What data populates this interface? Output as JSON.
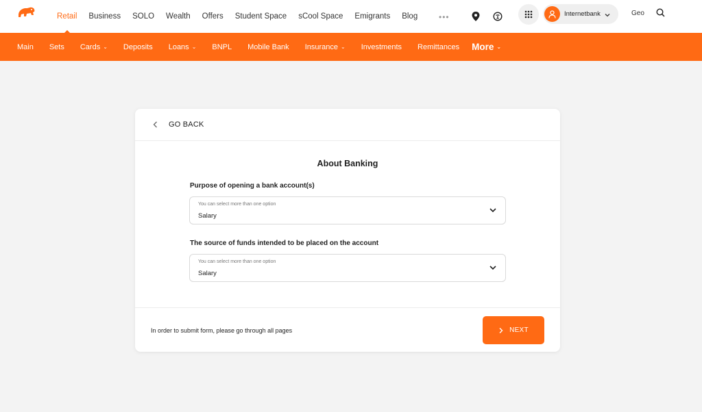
{
  "colors": {
    "accent": "#ff6a14",
    "background": "#f3f3f3",
    "card": "#ffffff"
  },
  "topnav": {
    "items": [
      {
        "label": "Retail",
        "active": true
      },
      {
        "label": "Business"
      },
      {
        "label": "SOLO"
      },
      {
        "label": "Wealth"
      },
      {
        "label": "Offers"
      },
      {
        "label": "Student Space"
      },
      {
        "label": "sCool Space"
      },
      {
        "label": "Emigrants"
      },
      {
        "label": "Blog"
      }
    ],
    "more_dots": "•••",
    "icons": [
      "location-pin-icon",
      "accessibility-icon",
      "apps-grid-icon",
      "user-icon",
      "search-icon"
    ],
    "internetbank_label": "Internetbank",
    "language": "Geo"
  },
  "subnav": {
    "items": [
      {
        "label": "Main"
      },
      {
        "label": "Sets"
      },
      {
        "label": "Cards",
        "dropdown": true
      },
      {
        "label": "Deposits"
      },
      {
        "label": "Loans",
        "dropdown": true
      },
      {
        "label": "BNPL"
      },
      {
        "label": "Mobile Bank"
      },
      {
        "label": "Insurance",
        "dropdown": true
      },
      {
        "label": "Investments"
      },
      {
        "label": "Remittances"
      }
    ],
    "more_label": "More"
  },
  "form": {
    "back_label": "GO BACK",
    "title": "About Banking",
    "q1": {
      "label": "Purpose of opening a bank account(s)",
      "placeholder": "You can select more than one option",
      "value": "Salary"
    },
    "q2": {
      "label": "The source of funds intended to be placed on the account",
      "placeholder": "You can select more than one option",
      "value": "Salary"
    },
    "footer_note": "In order to submit form, please go through all pages",
    "next_label": "NEXT"
  }
}
